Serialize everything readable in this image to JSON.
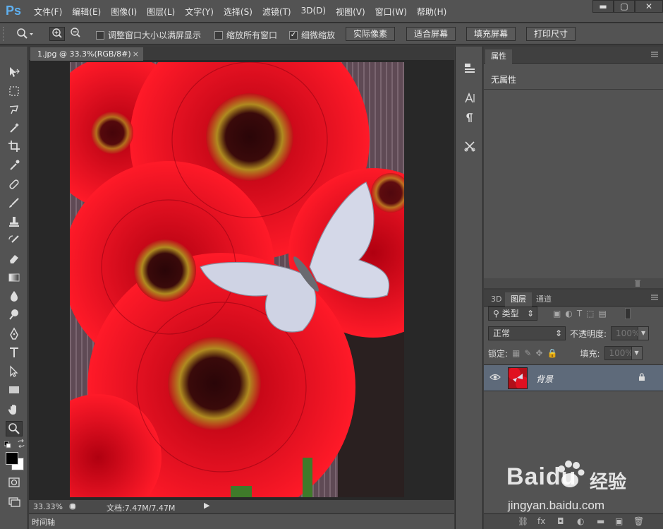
{
  "app": {
    "logo": "Ps"
  },
  "menu": [
    "文件(F)",
    "编辑(E)",
    "图像(I)",
    "图层(L)",
    "文字(Y)",
    "选择(S)",
    "滤镜(T)",
    "3D(D)",
    "视图(V)",
    "窗口(W)",
    "帮助(H)"
  ],
  "window_controls": {
    "minimize": "▬",
    "maximize": "▢",
    "close": "✕"
  },
  "options": {
    "checks": [
      {
        "label": "调整窗口大小以满屏显示",
        "checked": false
      },
      {
        "label": "缩放所有窗口",
        "checked": false
      },
      {
        "label": "细微缩放",
        "checked": true
      }
    ],
    "buttons": [
      "实际像素",
      "适合屏幕",
      "填充屏幕",
      "打印尺寸"
    ],
    "check_mark": "✓"
  },
  "document": {
    "tab_title": "1.jpg @ 33.3%(RGB/8#)",
    "tab_close": "×",
    "zoom": "33.33%",
    "info": "文档:7.47M/7.47M",
    "status_arrow": "▶"
  },
  "timeline": {
    "label": "时间轴"
  },
  "properties": {
    "tab": "属性",
    "content": "无属性"
  },
  "layers": {
    "tabs": [
      "3D",
      "图层",
      "通道"
    ],
    "filter_kind": "类型",
    "blend_mode": "正常",
    "opacity_label": "不透明度:",
    "opacity_value": "100%",
    "lock_label": "锁定:",
    "fill_label": "填充:",
    "fill_value": "100%",
    "layer_name": "背景",
    "foot_icons": [
      "⛓",
      "fx",
      "◘",
      "◐",
      "▬",
      "▣",
      "🗑"
    ]
  },
  "watermark": {
    "brand": "Baidu",
    "product": "经验",
    "url": "jingyan.baidu.com"
  },
  "colors": {
    "accent": "#5fb0f0",
    "panel": "#535353",
    "canvas": "#282828",
    "layer_selected": "#5e6a7a"
  }
}
